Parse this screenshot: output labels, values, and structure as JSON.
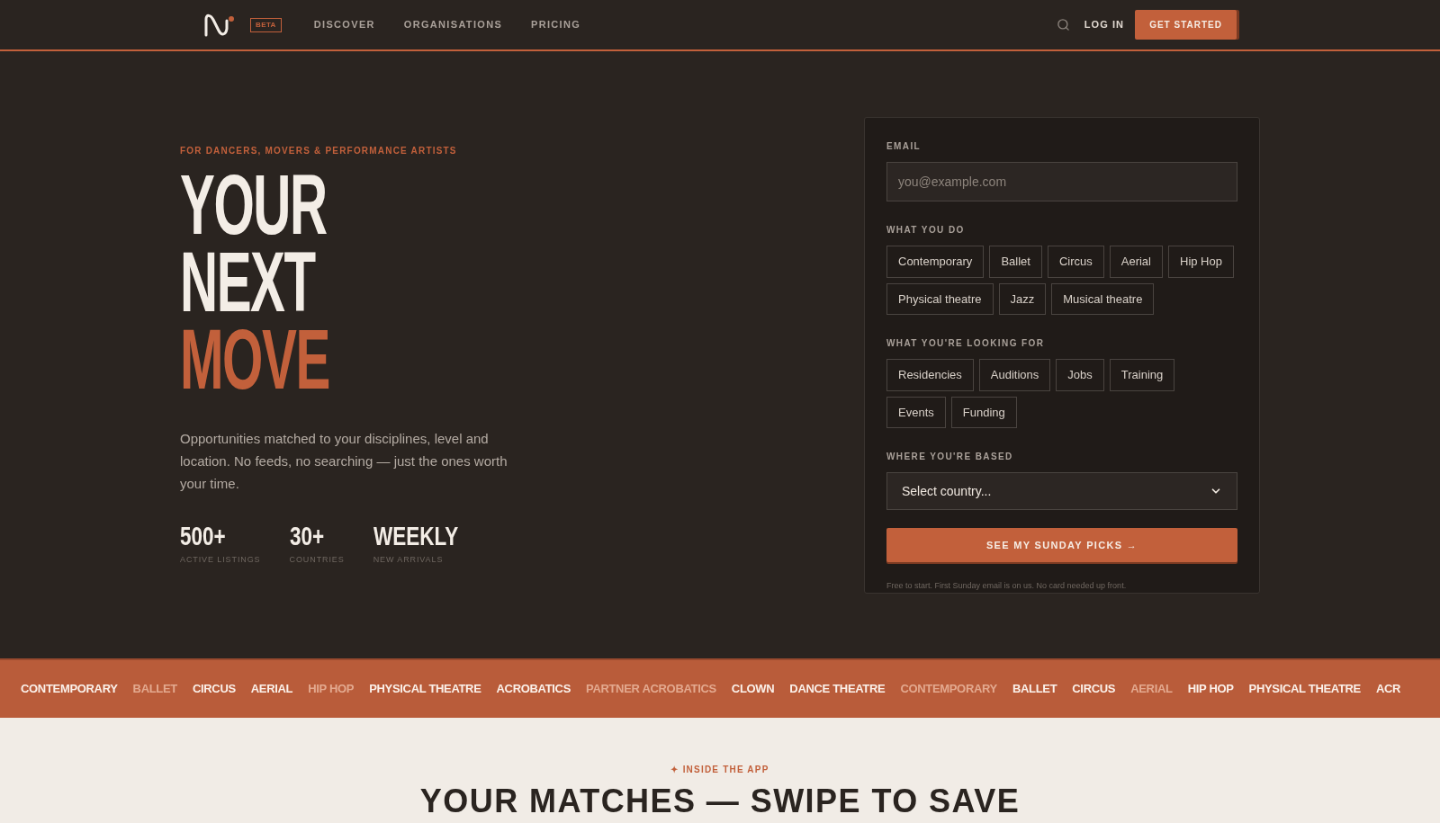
{
  "nav": {
    "badge": "BETA",
    "links": [
      "DISCOVER",
      "ORGANISATIONS",
      "PRICING"
    ],
    "login": "LOG IN",
    "cta": "GET STARTED"
  },
  "hero": {
    "eyebrow": "FOR DANCERS, MOVERS & PERFORMANCE ARTISTS",
    "headline": [
      {
        "text": "YOUR",
        "accent": false
      },
      {
        "text": "NEXT",
        "accent": false
      },
      {
        "text": "MOVE",
        "accent": true
      }
    ],
    "description": "Opportunities matched to your disciplines, level and location. No feeds, no searching — just the ones worth your time.",
    "stats": [
      {
        "value": "500+",
        "label": "ACTIVE LISTINGS"
      },
      {
        "value": "30+",
        "label": "COUNTRIES"
      },
      {
        "value": "WEEKLY",
        "label": "NEW ARRIVALS"
      }
    ]
  },
  "signup": {
    "email_label": "EMAIL",
    "email_placeholder": "you@example.com",
    "do_label": "WHAT YOU DO",
    "disciplines": [
      {
        "label": "Contemporary",
        "selected": false
      },
      {
        "label": "Ballet",
        "selected": false
      },
      {
        "label": "Circus",
        "selected": false
      },
      {
        "label": "Aerial",
        "selected": false
      },
      {
        "label": "Hip Hop",
        "selected": false
      },
      {
        "label": "Physical theatre",
        "selected": false
      },
      {
        "label": "Jazz",
        "selected": false
      },
      {
        "label": "Musical theatre",
        "selected": false
      }
    ],
    "looking_label": "WHAT YOU'RE LOOKING FOR",
    "interests": [
      {
        "label": "Residencies",
        "selected": false
      },
      {
        "label": "Auditions",
        "selected": false
      },
      {
        "label": "Jobs",
        "selected": false
      },
      {
        "label": "Training",
        "selected": false
      },
      {
        "label": "Events",
        "selected": false
      },
      {
        "label": "Funding",
        "selected": false
      }
    ],
    "based_label": "WHERE YOU'RE BASED",
    "country": "Select country...",
    "submit": "SEE MY SUNDAY PICKS →",
    "note": "Free to start. First Sunday email is on us. No card needed up front."
  },
  "ticker": [
    {
      "text": "CONTEMPORARY",
      "dim": false
    },
    {
      "text": "BALLET",
      "dim": true
    },
    {
      "text": "CIRCUS",
      "dim": false
    },
    {
      "text": "AERIAL",
      "dim": false
    },
    {
      "text": "HIP HOP",
      "dim": true
    },
    {
      "text": "PHYSICAL THEATRE",
      "dim": false
    },
    {
      "text": "ACROBATICS",
      "dim": false
    },
    {
      "text": "PARTNER ACROBATICS",
      "dim": true
    },
    {
      "text": "CLOWN",
      "dim": false
    },
    {
      "text": "DANCE THEATRE",
      "dim": false
    },
    {
      "text": "CONTEMPORARY",
      "dim": true
    },
    {
      "text": "BALLET",
      "dim": false
    },
    {
      "text": "CIRCUS",
      "dim": false
    },
    {
      "text": "AERIAL",
      "dim": true
    },
    {
      "text": "HIP HOP",
      "dim": false
    },
    {
      "text": "PHYSICAL THEATRE",
      "dim": false
    },
    {
      "text": "ACR",
      "dim": false
    }
  ],
  "section": {
    "eyebrow": "✦ INSIDE THE APP",
    "heading": "YOUR MATCHES — SWIPE TO SAVE"
  }
}
